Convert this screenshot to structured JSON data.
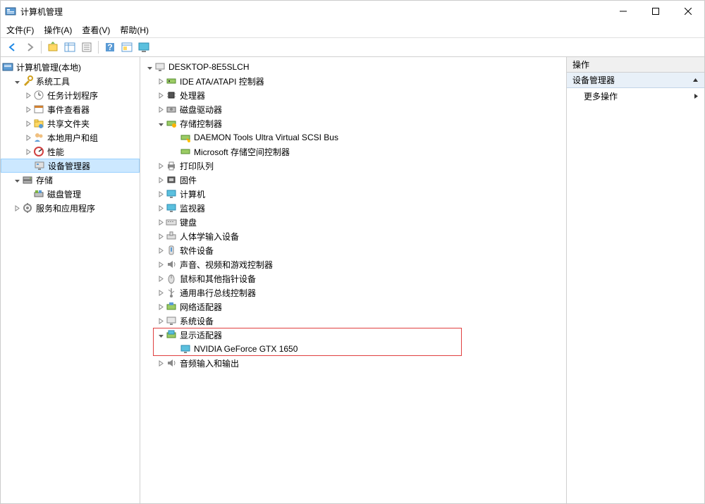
{
  "window": {
    "title": "计算机管理"
  },
  "menu": {
    "file": "文件(F)",
    "action": "操作(A)",
    "view": "查看(V)",
    "help": "帮助(H)"
  },
  "left_tree": {
    "root": "计算机管理(本地)",
    "system_tools": "系统工具",
    "task_scheduler": "任务计划程序",
    "event_viewer": "事件查看器",
    "shared_folders": "共享文件夹",
    "local_users": "本地用户和组",
    "performance": "性能",
    "device_manager": "设备管理器",
    "storage": "存储",
    "disk_management": "磁盘管理",
    "services_apps": "服务和应用程序"
  },
  "center_tree": {
    "root": "DESKTOP-8E5SLCH",
    "ide": "IDE ATA/ATAPI 控制器",
    "cpu": "处理器",
    "disk_drives": "磁盘驱动器",
    "storage_ctrl": "存储控制器",
    "daemon": "DAEMON Tools Ultra Virtual SCSI Bus",
    "ms_storage": "Microsoft 存储空间控制器",
    "print_queue": "打印队列",
    "firmware": "固件",
    "computer": "计算机",
    "monitors": "监视器",
    "keyboards": "键盘",
    "hid": "人体学输入设备",
    "software_dev": "软件设备",
    "sound": "声音、视频和游戏控制器",
    "mice": "鼠标和其他指针设备",
    "usb": "通用串行总线控制器",
    "network": "网络适配器",
    "system_dev": "系统设备",
    "display": "显示适配器",
    "gpu": "NVIDIA GeForce GTX 1650",
    "audio_io": "音频输入和输出"
  },
  "right_pane": {
    "header": "操作",
    "section": "设备管理器",
    "more_actions": "更多操作"
  }
}
